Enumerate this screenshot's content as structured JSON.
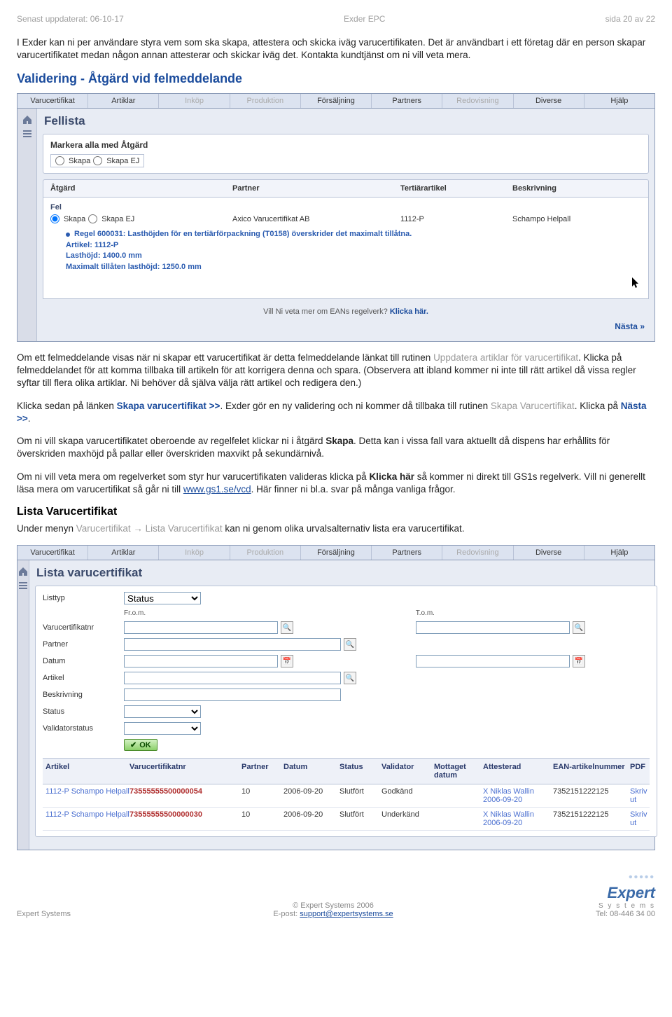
{
  "header": {
    "left": "Senast uppdaterat: 06-10-17",
    "center": "Exder EPC",
    "right": "sida 20 av 22"
  },
  "intro": "I Exder kan ni per användare styra vem som ska skapa, attestera och skicka iväg varucertifikaten. Det är användbart i ett företag där en person skapar varucertifikatet medan någon annan attesterar och skickar iväg det. Kontakta kundtjänst om ni vill veta mera.",
  "sec_validering": "Validering - Åtgärd vid felmeddelande",
  "menu": {
    "items": [
      {
        "label": "Varucertifikat",
        "disabled": false
      },
      {
        "label": "Artiklar",
        "disabled": false
      },
      {
        "label": "Inköp",
        "disabled": true
      },
      {
        "label": "Produktion",
        "disabled": true
      },
      {
        "label": "Försäljning",
        "disabled": false
      },
      {
        "label": "Partners",
        "disabled": false
      },
      {
        "label": "Redovisning",
        "disabled": true
      },
      {
        "label": "Diverse",
        "disabled": false
      },
      {
        "label": "Hjälp",
        "disabled": false
      }
    ]
  },
  "fellista": {
    "title": "Fellista",
    "markera": "Markera alla med Åtgärd",
    "skapa": "Skapa",
    "skapa_ej": "Skapa EJ",
    "cols": {
      "atgard": "Åtgärd",
      "partner": "Partner",
      "tertiar": "Tertiärartikel",
      "besk": "Beskrivning"
    },
    "fel": "Fel",
    "row": {
      "partner": "Axico Varucertifikat AB",
      "tertiar": "1112-P",
      "besk": "Schampo Helpall"
    },
    "err_rule": "Regel 600031: Lasthöjden för en tertiärförpackning (T0158) överskrider det maximalt tillåtna.",
    "err_art": "Artikel: 1112-P",
    "err_lh": "Lasthöjd: 1400.0 mm",
    "err_max": "Maximalt tillåten lasthöjd: 1250.0 mm",
    "footer_q": "Vill Ni veta mer om EANs regelverk?",
    "footer_link": "Klicka här.",
    "nasta": "Nästa »"
  },
  "para1a": "Om ett felmeddelande visas när ni skapar ett varucertifikat är detta felmeddelande länkat till rutinen ",
  "para1b": "Uppdatera artiklar för varucertifikat",
  "para1c": ". Klicka på felmeddelandet för att komma tillbaka till artikeln för att korrigera denna och spara. (Observera att ibland kommer ni inte till rätt artikel då vissa regler syftar till flera olika artiklar. Ni behöver då själva välja rätt artikel och redigera den.)",
  "para2a": "Klicka sedan på länken ",
  "para2b": "Skapa varucertifikat >>",
  "para2c": ". Exder gör en ny validering och ni kommer då tillbaka till rutinen ",
  "para2d": "Skapa Varucertifikat",
  "para2e": ". Klicka på ",
  "para2f": "Nästa >>",
  "para2g": ".",
  "para3a": "Om ni vill skapa varucertifikatet oberoende av regelfelet klickar ni i åtgärd ",
  "para3b": "Skapa",
  "para3c": ". Detta kan i vissa fall vara aktuellt då dispens har erhållits för överskriden maxhöjd på pallar eller överskriden maxvikt på sekundärnivå.",
  "para4a": "Om ni vill veta mera om regelverket som styr hur varucertifikaten valideras klicka på ",
  "para4b": "Klicka här",
  "para4c": " så kommer ni direkt till GS1s regelverk. Vill ni generellt läsa mera om varucertifikat så går ni till ",
  "para4d": "www.gs1.se/vcd",
  "para4e": ". Här finner ni bl.a. svar på många vanliga frågor.",
  "sec_lista_title": "Lista Varucertifikat",
  "lista_intro_a": "Under menyn ",
  "lista_intro_b": "Varucertifikat",
  "lista_intro_arrow": " → ",
  "lista_intro_c": "Lista Varucertifikat",
  "lista_intro_d": " kan ni genom olika urvalsalternativ lista era varucertifikat.",
  "lista": {
    "title": "Lista varucertifikat",
    "labels": {
      "listtyp": "Listtyp",
      "from": "Fr.o.m.",
      "tom": "T.o.m.",
      "vcn": "Varucertifikatnr",
      "partner": "Partner",
      "datum": "Datum",
      "artikel": "Artikel",
      "besk": "Beskrivning",
      "status": "Status",
      "valstat": "Validatorstatus"
    },
    "listtyp_value": "Status",
    "ok": "OK",
    "head": {
      "art": "Artikel",
      "vcn": "Varucertifikatnr",
      "ptr": "Partner",
      "date": "Datum",
      "stat": "Status",
      "val": "Validator",
      "mott": "Mottaget datum",
      "att": "Attesterad",
      "ean": "EAN-artikelnummer",
      "pdf": "PDF"
    },
    "rows": [
      {
        "art": "1112-P Schampo Helpall",
        "vcn": "73555555500000054",
        "ptr": "10",
        "date": "2006-09-20",
        "stat": "Slutfört",
        "val": "Godkänd",
        "mott": "",
        "att": "X Niklas Wallin 2006-09-20",
        "ean": "7352151222125",
        "pdf": "Skriv ut"
      },
      {
        "art": "1112-P Schampo Helpall",
        "vcn": "73555555500000030",
        "ptr": "10",
        "date": "2006-09-20",
        "stat": "Slutfört",
        "val": "Underkänd",
        "mott": "",
        "att": "X Niklas Wallin 2006-09-20",
        "ean": "7352151222125",
        "pdf": "Skriv ut"
      }
    ]
  },
  "footer": {
    "copyright": "© Expert Systems 2006",
    "left": "Expert Systems",
    "eprefix": "E-post: ",
    "email": "support@expertsystems.se",
    "tel": "Tel: 08-446 34 00",
    "logo_main": "Expert",
    "logo_sub": "S y s t e m s"
  }
}
